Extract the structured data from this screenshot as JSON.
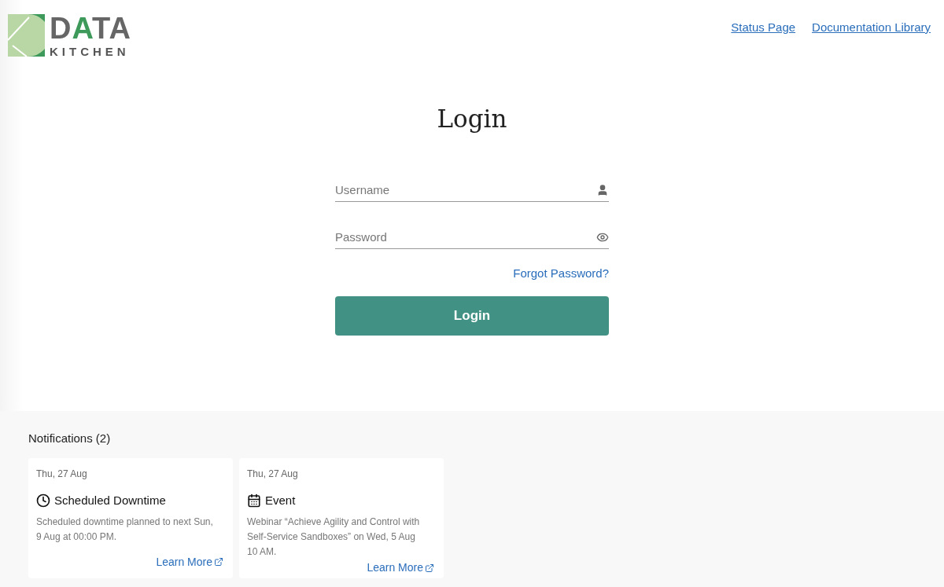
{
  "logo": {
    "word": [
      {
        "text": "D",
        "color": "#666666"
      },
      {
        "text": "A",
        "color": "#3d9a5a"
      },
      {
        "text": "TA",
        "color": "#666666"
      }
    ],
    "subword": "KITCHEN"
  },
  "header_links": [
    "Status Page",
    "Documentation Library"
  ],
  "title": "Login",
  "fields": [
    {
      "kind": "user",
      "placeholder": "Username"
    },
    {
      "kind": "password",
      "placeholder": "Password"
    }
  ],
  "forgot_link": "Forgot Password?",
  "login_button": "Login",
  "notifications": {
    "heading": "Notifications (2)",
    "items": [
      {
        "kind": "downtime",
        "date": "Thu, 27 Aug",
        "title": "Scheduled Downtime",
        "body": "Scheduled downtime planned to next Sun, 9 Aug at 00:00 PM.",
        "link": "Learn More"
      },
      {
        "kind": "event",
        "date": "Thu, 27 Aug",
        "title": "Event",
        "body": "Webinar “Achieve Agility and Control with Self-Service Sandboxes” on Wed, 5 Aug 10 AM.",
        "link": "Learn More"
      }
    ]
  }
}
